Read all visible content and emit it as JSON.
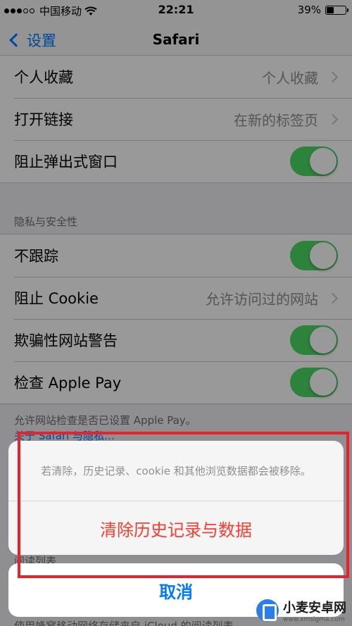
{
  "status_bar": {
    "carrier": "中国移动",
    "time": "22:21",
    "battery": "39%",
    "battery_level": 0.39
  },
  "nav": {
    "back_label": "设置",
    "title": "Safari"
  },
  "general": [
    {
      "label": "个人收藏",
      "value": "个人收藏",
      "accessory": "disclosure"
    },
    {
      "label": "打开链接",
      "value": "在新的标签页",
      "accessory": "disclosure"
    },
    {
      "label": "阻止弹出式窗口",
      "accessory": "toggle",
      "on": true
    }
  ],
  "privacy": {
    "header": "隐私与安全性",
    "rows": [
      {
        "label": "不跟踪",
        "accessory": "toggle",
        "on": true
      },
      {
        "label": "阻止 Cookie",
        "value": "允许访问过的网站",
        "accessory": "disclosure"
      },
      {
        "label": "欺骗性网站警告",
        "accessory": "toggle",
        "on": true
      },
      {
        "label": "检查 Apple Pay",
        "accessory": "toggle",
        "on": true
      }
    ],
    "footer": "允许网站检查是否已设置 Apple Pay。",
    "footer_link": "关于 Safari 与隐私…"
  },
  "reading_list_header": "阅读列表",
  "action_sheet": {
    "message": "若清除，历史记录、cookie 和其他浏览数据都会被移除。",
    "destructive_label": "清除历史记录与数据",
    "cancel_label": "取消"
  },
  "bottom_footer": "使用蜂窝移动网络存储来自 iCloud 的阅读列表",
  "watermark": {
    "name": "小麦安卓网",
    "url": "www.xmsigma.com"
  },
  "colors": {
    "accent": "#007aff",
    "destructive": "#ff3b30",
    "toggle_on": "#4cd964",
    "highlight": "#e8212a"
  }
}
